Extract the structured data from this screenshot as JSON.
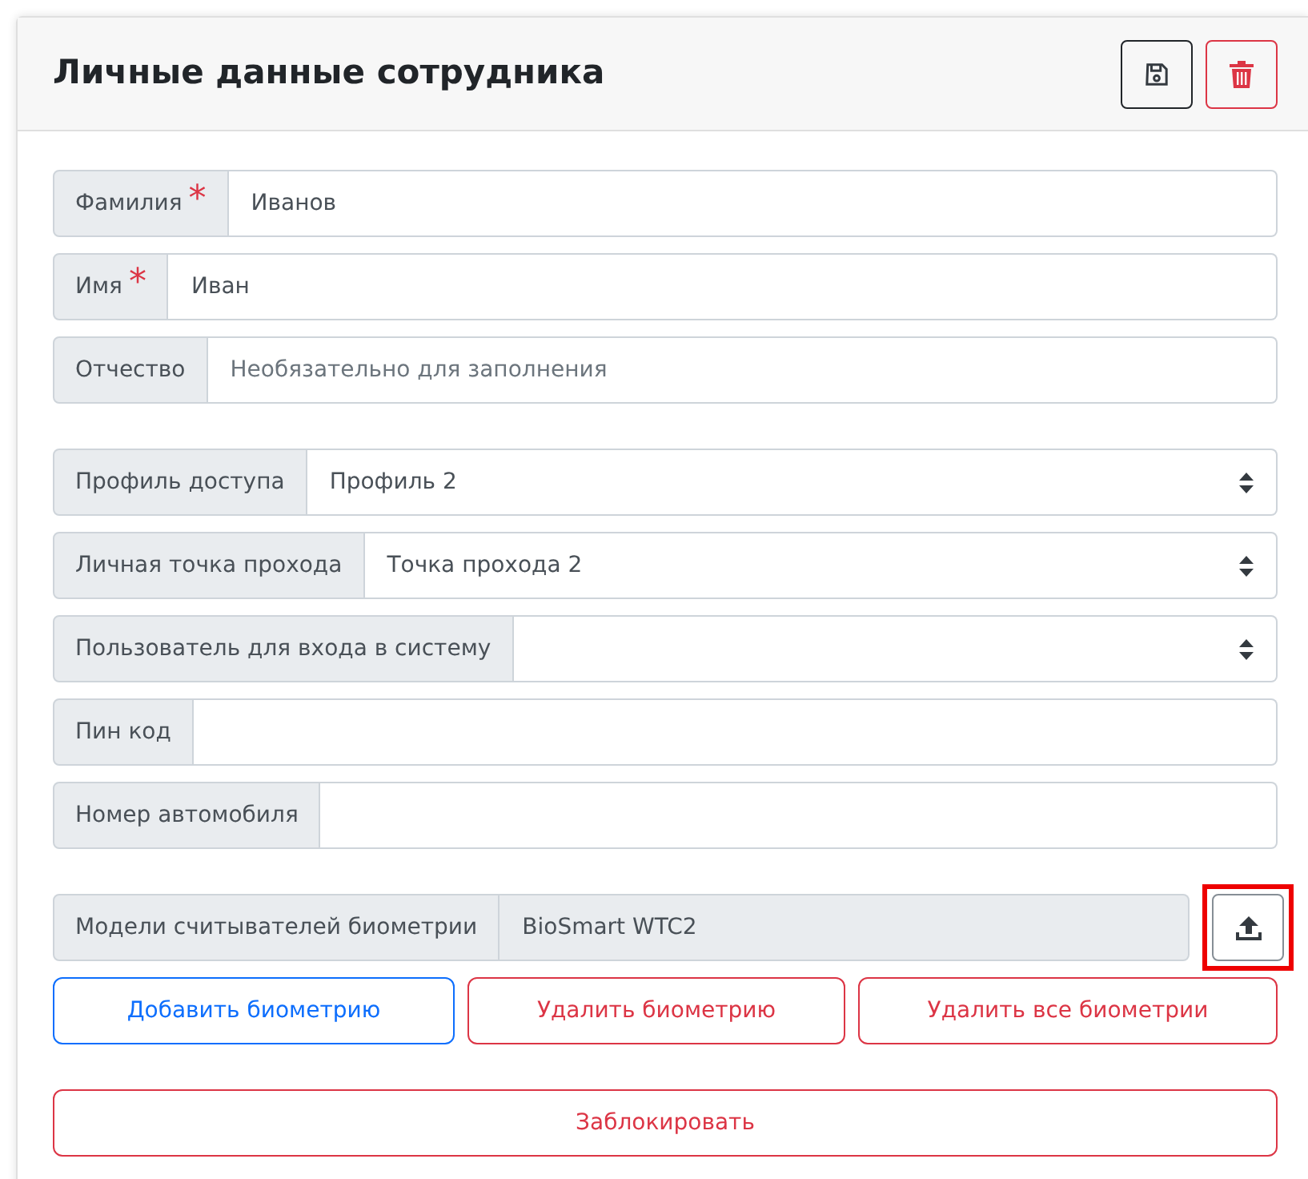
{
  "card": {
    "title": "Личные данные сотрудника",
    "header_buttons": [
      {
        "kind": "save"
      },
      {
        "kind": "delete"
      }
    ]
  },
  "groups": [
    [
      {
        "kind": "text",
        "label": "Фамилия",
        "required_mark": "*",
        "value": "Иванов"
      },
      {
        "kind": "text",
        "label": "Имя",
        "required_mark": "*",
        "value": "Иван"
      },
      {
        "kind": "text",
        "label": "Отчество",
        "placeholder": "Необязательно для заполнения"
      }
    ],
    [
      {
        "kind": "select",
        "label": "Профиль доступа",
        "value": "Профиль 2"
      },
      {
        "kind": "select",
        "label": "Личная точка прохода",
        "value": "Точка прохода 2"
      },
      {
        "kind": "select",
        "label": "Пользователь для входа в систему"
      },
      {
        "kind": "text",
        "label": "Пин код"
      },
      {
        "kind": "text",
        "label": "Номер автомобиля"
      }
    ]
  ],
  "biometrics": {
    "label": "Модели считывателей биометрии",
    "value": "BioSmart WTC2",
    "upload_highlighted": true
  },
  "actions": [
    {
      "label": "Добавить биометрию",
      "kind": "add"
    },
    {
      "label": "Удалить биометрию",
      "kind": "delete"
    },
    {
      "label": "Удалить все биометрии",
      "kind": "delete"
    }
  ],
  "block_button": {
    "label": "Заблокировать",
    "kind": "block"
  }
}
